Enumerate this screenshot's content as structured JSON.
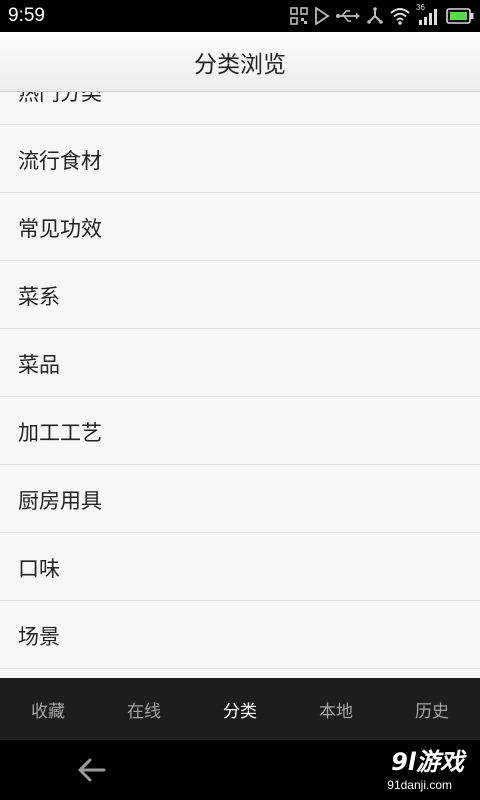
{
  "status_bar": {
    "time": "9:59",
    "network_label": "36",
    "icons": [
      "qr-icon",
      "play-icon",
      "usb-icon",
      "debug-icon",
      "wifi-icon",
      "signal-icon",
      "battery-icon"
    ]
  },
  "header": {
    "title": "分类浏览"
  },
  "category_list": {
    "items": [
      {
        "label": "热门分类"
      },
      {
        "label": "流行食材"
      },
      {
        "label": "常见功效"
      },
      {
        "label": "菜系"
      },
      {
        "label": "菜品"
      },
      {
        "label": "加工工艺"
      },
      {
        "label": "厨房用具"
      },
      {
        "label": "口味"
      },
      {
        "label": "场景"
      }
    ]
  },
  "tab_bar": {
    "tabs": [
      {
        "label": "收藏",
        "active": false
      },
      {
        "label": "在线",
        "active": false
      },
      {
        "label": "分类",
        "active": true
      },
      {
        "label": "本地",
        "active": false
      },
      {
        "label": "历史",
        "active": false
      }
    ]
  },
  "nav_bar": {
    "back_icon": "back-arrow-icon"
  },
  "watermark": {
    "brand": "9l游戏",
    "domain": "91danji.com"
  },
  "colors": {
    "status_bg": "#000000",
    "tab_bg": "#1d1d1d",
    "tab_inactive": "#a5a5a5",
    "tab_active": "#ffffff",
    "battery_green": "#5cd84a"
  }
}
